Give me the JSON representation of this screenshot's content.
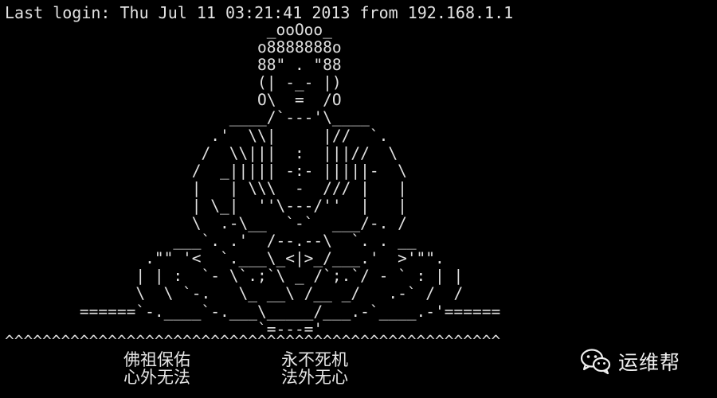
{
  "terminal": {
    "login_message": "Last login: Thu Jul 11 03:21:41 2013 from 192.168.1.1",
    "ascii_art": [
      "                            _ooOoo_",
      "                           o8888888o",
      "                           88\" . \"88",
      "                           (| -_- |)",
      "                           O\\  =  /O",
      "                        ____/`---'\\____",
      "                      .'  \\\\|     |//  `.",
      "                     /  \\\\|||  :  |||//  \\",
      "                    /  _||||| -:- |||||-  \\",
      "                    |   | \\\\\\  -  /// |   |",
      "                    | \\_|  ''\\---/''  |   |",
      "                    \\  .-\\__  `-`  ___/-. /",
      "                  ___`. .'  /--.--\\  `. . __",
      "               .\"\" '<  `.___\\_<|>_/___.'  >'\"\".",
      "              | | :  `- \\`.;`\\ _ /`;.`/ - ` : | |",
      "              \\  \\ `-.   \\_ __\\ /__ _/   .-` /  /",
      "        ======`-.____`-.___\\_____/___.-`____.-'======",
      "                           `=---='"
    ],
    "caret_line": "^^^^^^^^^^^^^^^^^^^^^^^^^^^^^^^^^^^^^^^^^^^^^^^^^^^^^",
    "verses": {
      "left_line1": "佛祖保佑",
      "left_line2": "心外无法",
      "right_line1": "永不死机",
      "right_line2": "法外无心"
    }
  },
  "watermark": {
    "icon": "wechat-icon",
    "label": "运维帮"
  }
}
